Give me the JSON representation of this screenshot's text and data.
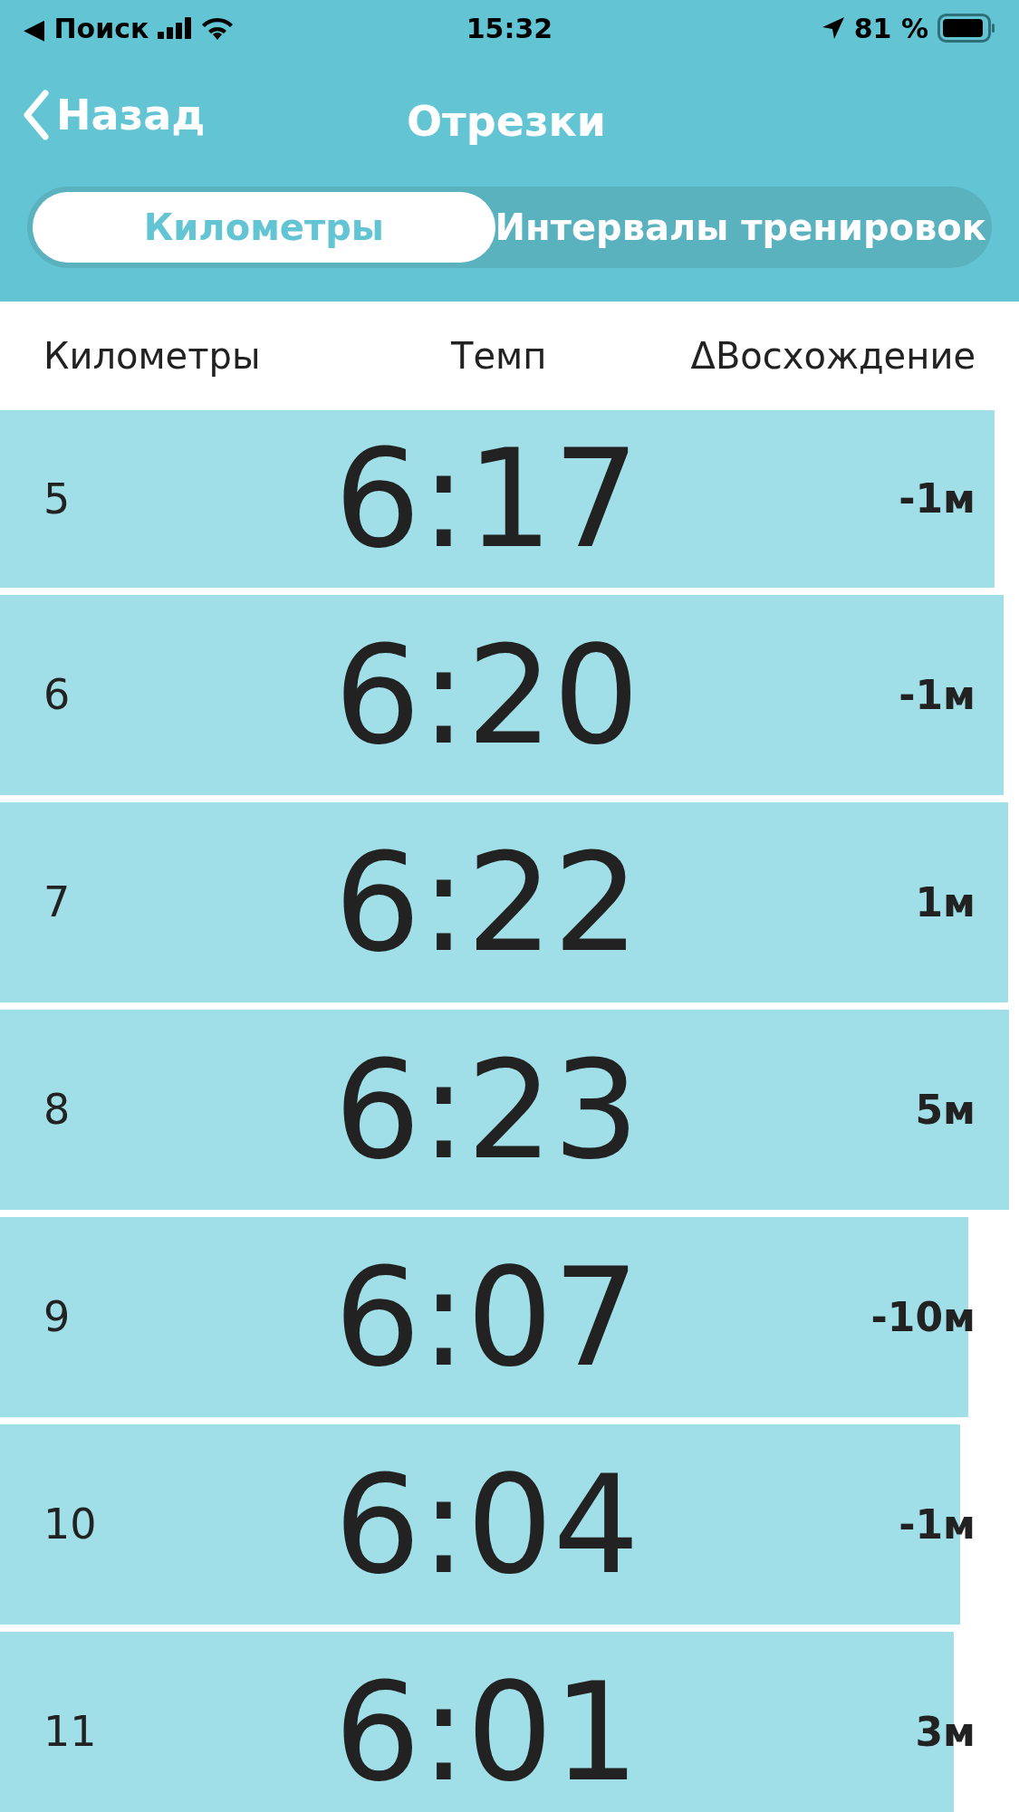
{
  "status_bar": {
    "back_label": "◀ Поиск",
    "time": "15:32",
    "battery": "81 %"
  },
  "nav": {
    "back": "Назад",
    "title": "Отрезки"
  },
  "tabs": [
    {
      "label": "Километры",
      "selected": true
    },
    {
      "label": "Интервалы тренировок",
      "selected": false
    }
  ],
  "table": {
    "columns": [
      "Километры",
      "Темп",
      "ΔВосхождение"
    ],
    "rows": [
      {
        "km": "5",
        "pace": "6:17",
        "elevation": "-1м",
        "level": 0.976
      },
      {
        "km": "6",
        "pace": "6:20",
        "elevation": "-1м",
        "level": 0.985
      },
      {
        "km": "7",
        "pace": "6:22",
        "elevation": "1м",
        "level": 0.989
      },
      {
        "km": "8",
        "pace": "6:23",
        "elevation": "5м",
        "level": 0.99
      },
      {
        "km": "9",
        "pace": "6:07",
        "elevation": "-10м",
        "level": 0.95
      },
      {
        "km": "10",
        "pace": "6:04",
        "elevation": "-1м",
        "level": 0.942
      },
      {
        "km": "11",
        "pace": "6:01",
        "elevation": "3м",
        "level": 0.936
      }
    ]
  }
}
